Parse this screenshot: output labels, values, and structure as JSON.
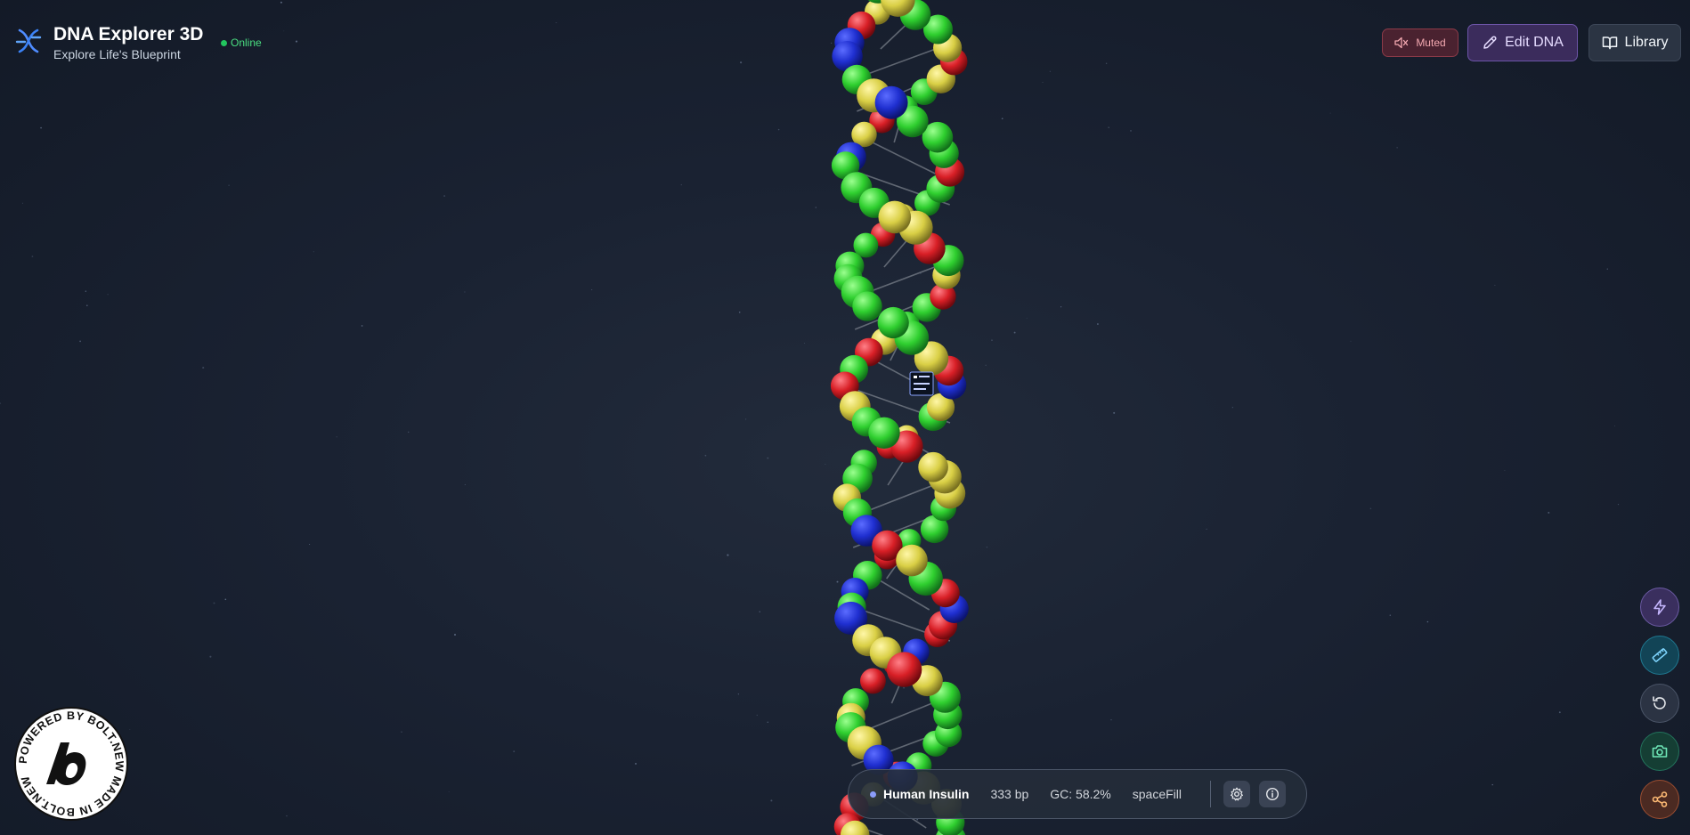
{
  "app": {
    "title": "DNA Explorer 3D",
    "subtitle": "Explore Life's Blueprint",
    "status": "Online"
  },
  "toolbar": {
    "muted_label": "Muted",
    "edit_label": "Edit DNA",
    "library_label": "Library"
  },
  "tools": [
    {
      "name": "lightning-icon"
    },
    {
      "name": "ruler-icon"
    },
    {
      "name": "reset-icon"
    },
    {
      "name": "camera-icon"
    },
    {
      "name": "share-icon"
    }
  ],
  "infobar": {
    "sequence_name": "Human Insulin",
    "length": "333 bp",
    "gc": "GC: 58.2%",
    "mode": "spaceFill"
  },
  "badge": {
    "text": "POWERED BY BOLT.NEW  MADE IN BOLT.NEW  "
  },
  "colors": {
    "adenine": "#1f2fd0",
    "thymine": "#d9cf45",
    "guanine": "#2fcf2f",
    "cytosine": "#d81f26",
    "accent": "#8b6cf0"
  }
}
